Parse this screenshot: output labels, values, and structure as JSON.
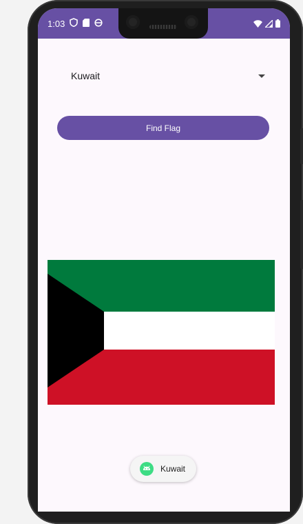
{
  "status_bar": {
    "time": "1:03",
    "icons": [
      "shield-icon",
      "sd-card-icon",
      "sync-icon",
      "wifi-icon",
      "signal-icon",
      "battery-icon"
    ],
    "background": "#6750a4"
  },
  "spinner": {
    "selected": "Kuwait",
    "arrow_icon": "dropdown-arrow-icon"
  },
  "find_button": {
    "label": "Find Flag",
    "color": "#6750a4"
  },
  "flag": {
    "country": "Kuwait",
    "colors": {
      "green": "#007a3d",
      "white": "#ffffff",
      "red": "#ce1126",
      "black": "#000000"
    }
  },
  "toast": {
    "text": "Kuwait",
    "icon": "android-icon"
  }
}
